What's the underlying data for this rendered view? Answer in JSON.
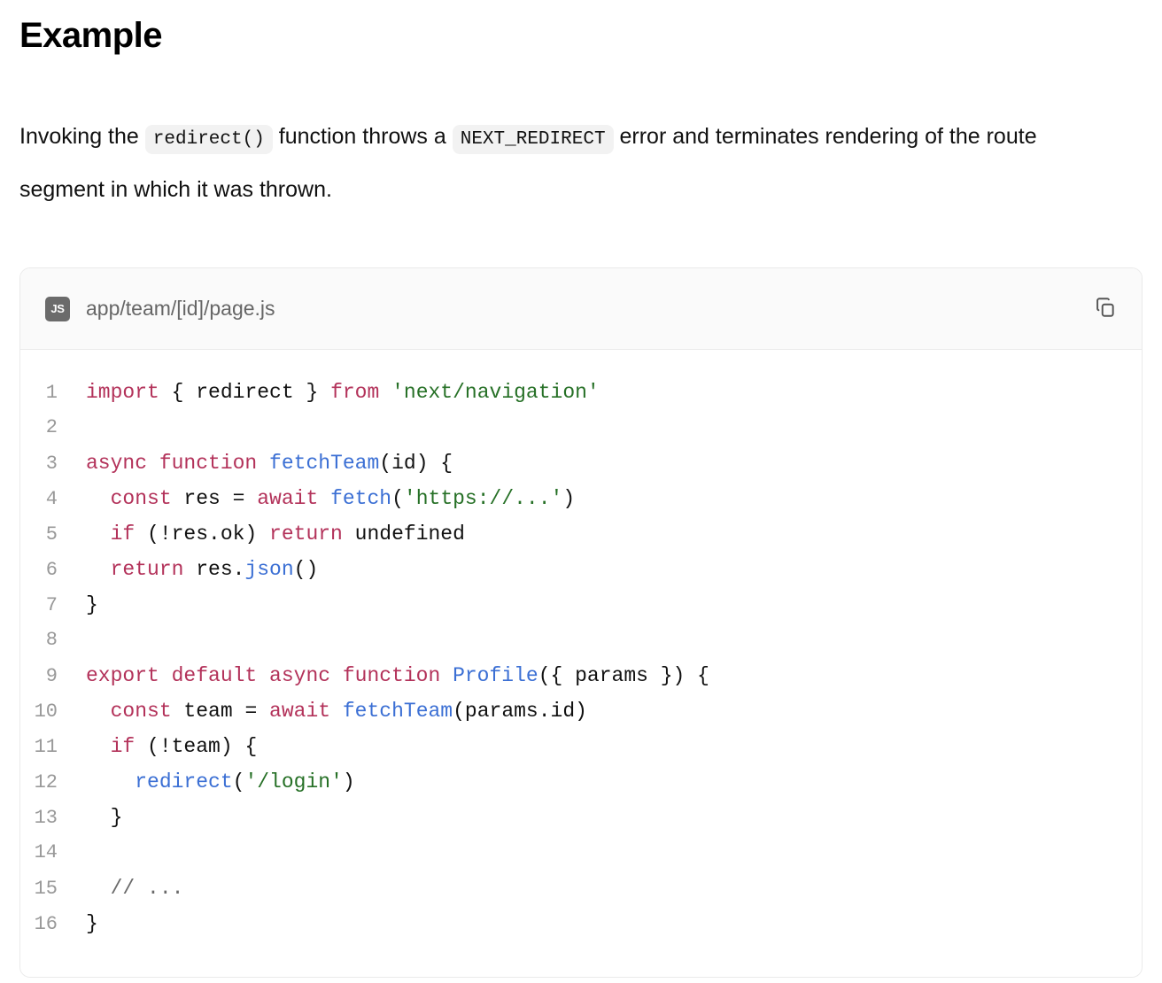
{
  "page": {
    "title": "Example"
  },
  "paragraph": {
    "part1": "Invoking the",
    "code1": "redirect()",
    "part2": "function throws a",
    "code2": "NEXT_REDIRECT",
    "part3": "error and terminates rendering of the route segment in which it was thrown."
  },
  "code_block": {
    "language_badge": "JS",
    "file_name": "app/team/[id]/page.js",
    "copy_icon": "copy-icon",
    "colors": {
      "keyword": "#b3325a",
      "string": "#267026",
      "function": "#3b6fd4",
      "plain": "#111111",
      "comment": "#6a6a6a",
      "line_number": "#999999",
      "header_background": "#fafafa",
      "border": "#eaeaea",
      "badge_background": "#6b6b6b"
    },
    "lines": [
      {
        "n": "1",
        "tokens": [
          {
            "t": "import",
            "c": "kw"
          },
          {
            "t": " { redirect } ",
            "c": "pl"
          },
          {
            "t": "from",
            "c": "kw"
          },
          {
            "t": " ",
            "c": "pl"
          },
          {
            "t": "'next/navigation'",
            "c": "str"
          }
        ]
      },
      {
        "n": "2",
        "tokens": []
      },
      {
        "n": "3",
        "tokens": [
          {
            "t": "async function ",
            "c": "kw"
          },
          {
            "t": "fetchTeam",
            "c": "fn"
          },
          {
            "t": "(id) {",
            "c": "pl"
          }
        ]
      },
      {
        "n": "4",
        "tokens": [
          {
            "t": "  ",
            "c": "pl"
          },
          {
            "t": "const",
            "c": "kw"
          },
          {
            "t": " res = ",
            "c": "pl"
          },
          {
            "t": "await",
            "c": "kw"
          },
          {
            "t": " ",
            "c": "pl"
          },
          {
            "t": "fetch",
            "c": "fn"
          },
          {
            "t": "(",
            "c": "pl"
          },
          {
            "t": "'https://...'",
            "c": "str"
          },
          {
            "t": ")",
            "c": "pl"
          }
        ]
      },
      {
        "n": "5",
        "tokens": [
          {
            "t": "  ",
            "c": "pl"
          },
          {
            "t": "if",
            "c": "kw"
          },
          {
            "t": " (!res.ok) ",
            "c": "pl"
          },
          {
            "t": "return",
            "c": "kw"
          },
          {
            "t": " undefined",
            "c": "pl"
          }
        ]
      },
      {
        "n": "6",
        "tokens": [
          {
            "t": "  ",
            "c": "pl"
          },
          {
            "t": "return",
            "c": "kw"
          },
          {
            "t": " res.",
            "c": "pl"
          },
          {
            "t": "json",
            "c": "fn"
          },
          {
            "t": "()",
            "c": "pl"
          }
        ]
      },
      {
        "n": "7",
        "tokens": [
          {
            "t": "}",
            "c": "pl"
          }
        ]
      },
      {
        "n": "8",
        "tokens": []
      },
      {
        "n": "9",
        "tokens": [
          {
            "t": "export default async function ",
            "c": "kw"
          },
          {
            "t": "Profile",
            "c": "fn"
          },
          {
            "t": "({ params }) {",
            "c": "pl"
          }
        ]
      },
      {
        "n": "10",
        "tokens": [
          {
            "t": "  ",
            "c": "pl"
          },
          {
            "t": "const",
            "c": "kw"
          },
          {
            "t": " team = ",
            "c": "pl"
          },
          {
            "t": "await",
            "c": "kw"
          },
          {
            "t": " ",
            "c": "pl"
          },
          {
            "t": "fetchTeam",
            "c": "fn"
          },
          {
            "t": "(params.id)",
            "c": "pl"
          }
        ]
      },
      {
        "n": "11",
        "tokens": [
          {
            "t": "  ",
            "c": "pl"
          },
          {
            "t": "if",
            "c": "kw"
          },
          {
            "t": " (!team) {",
            "c": "pl"
          }
        ]
      },
      {
        "n": "12",
        "tokens": [
          {
            "t": "    ",
            "c": "pl"
          },
          {
            "t": "redirect",
            "c": "fn"
          },
          {
            "t": "(",
            "c": "pl"
          },
          {
            "t": "'/login'",
            "c": "str"
          },
          {
            "t": ")",
            "c": "pl"
          }
        ]
      },
      {
        "n": "13",
        "tokens": [
          {
            "t": "  }",
            "c": "pl"
          }
        ]
      },
      {
        "n": "14",
        "tokens": []
      },
      {
        "n": "15",
        "tokens": [
          {
            "t": "  ",
            "c": "pl"
          },
          {
            "t": "// ...",
            "c": "com"
          }
        ]
      },
      {
        "n": "16",
        "tokens": [
          {
            "t": "}",
            "c": "pl"
          }
        ]
      }
    ]
  }
}
